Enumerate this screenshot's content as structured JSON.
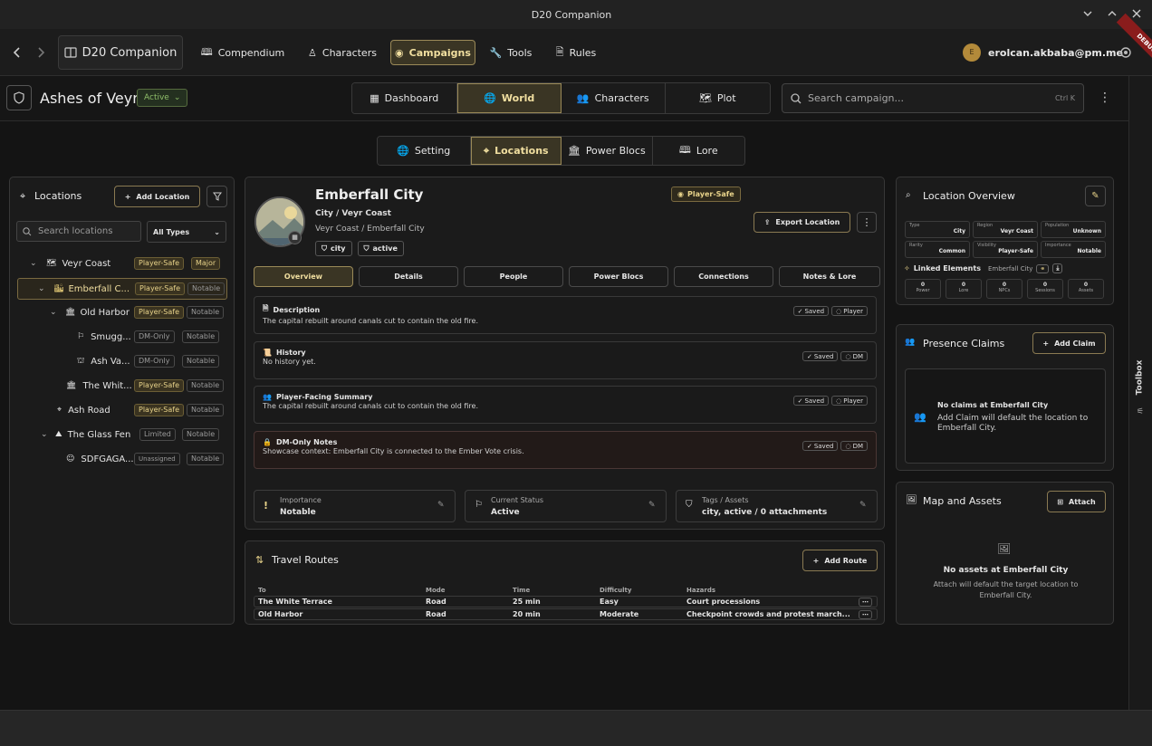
{
  "window": {
    "title": "D20 Companion"
  },
  "nav": {
    "app": "D20 Companion",
    "items": [
      "Compendium",
      "Characters",
      "Campaigns",
      "Tools",
      "Rules"
    ],
    "active": "Campaigns",
    "user": "erolcan.akbaba@pm.me",
    "avatar": "E",
    "debug": "DEBUG"
  },
  "campaign": {
    "name": "Ashes of Veyr",
    "status": "Active",
    "tabs": [
      "Dashboard",
      "World",
      "Characters",
      "Plot"
    ],
    "active_tab": "World",
    "search_placeholder": "Search campaign...",
    "shortcut": "Ctrl K"
  },
  "subtabs": {
    "items": [
      "Setting",
      "Locations",
      "Power Blocs",
      "Lore"
    ],
    "active": "Locations"
  },
  "left": {
    "title": "Locations",
    "add": "Add Location",
    "search_placeholder": "Search locations",
    "filter": "All Types",
    "tree": [
      {
        "label": "Veyr Coast",
        "badges": [
          "Player-Safe",
          "Major"
        ]
      },
      {
        "label": "Emberfall C...",
        "badges": [
          "Player-Safe",
          "Notable"
        ]
      },
      {
        "label": "Old Harbor",
        "badges": [
          "Player-Safe",
          "Notable"
        ]
      },
      {
        "label": "Smugg...",
        "badges": [
          "DM-Only",
          "Notable"
        ]
      },
      {
        "label": "Ash Va...",
        "badges": [
          "DM-Only",
          "Notable"
        ]
      },
      {
        "label": "The Whit...",
        "badges": [
          "Player-Safe",
          "Notable"
        ]
      },
      {
        "label": "Ash Road",
        "badges": [
          "Player-Safe",
          "Notable"
        ]
      },
      {
        "label": "The Glass Fen",
        "badges": [
          "Limited",
          "Notable"
        ]
      },
      {
        "label": "SDFGAGA...",
        "badges": [
          "Unassigned",
          "Notable"
        ]
      }
    ]
  },
  "detail": {
    "name": "Emberfall City",
    "type_line": "City / Veyr Coast",
    "path": "Veyr Coast / Emberfall City",
    "tags": [
      "city",
      "active"
    ],
    "visibility": "Player-Safe",
    "export": "Export Location",
    "tabs": [
      "Overview",
      "Details",
      "People",
      "Power Blocs",
      "Connections",
      "Notes & Lore"
    ],
    "active_tab": "Overview",
    "sections": [
      {
        "title": "Description",
        "text": "The capital rebuilt around canals cut to contain the old fire.",
        "saved": "Saved",
        "audience": "Player"
      },
      {
        "title": "History",
        "text": "No history yet.",
        "saved": "Saved",
        "audience": "DM"
      },
      {
        "title": "Player-Facing Summary",
        "text": "The capital rebuilt around canals cut to contain the old fire.",
        "saved": "Saved",
        "audience": "Player"
      },
      {
        "title": "DM-Only Notes",
        "text": "Showcase context: Emberfall City is connected to the Ember Vote crisis.",
        "saved": "Saved",
        "audience": "DM"
      }
    ],
    "facts": [
      {
        "label": "Importance",
        "value": "Notable"
      },
      {
        "label": "Current Status",
        "value": "Active"
      },
      {
        "label": "Tags / Assets",
        "value": "city, active / 0 attachments"
      }
    ]
  },
  "routes": {
    "title": "Travel Routes",
    "add": "Add Route",
    "columns": [
      "To",
      "Mode",
      "Time",
      "Difficulty",
      "Hazards"
    ],
    "rows": [
      [
        "The White Terrace",
        "Road",
        "25 min",
        "Easy",
        "Court processions"
      ],
      [
        "Old Harbor",
        "Road",
        "20 min",
        "Moderate",
        "Checkpoint crowds and protest march..."
      ]
    ]
  },
  "overview": {
    "title": "Location Overview",
    "stats": [
      {
        "k": "Type",
        "v": "City"
      },
      {
        "k": "Region",
        "v": "Veyr Coast"
      },
      {
        "k": "Population",
        "v": "Unknown"
      },
      {
        "k": "Rarity",
        "v": "Common"
      },
      {
        "k": "Visibility",
        "v": "Player-Safe"
      },
      {
        "k": "Importance",
        "v": "Notable"
      }
    ],
    "linked_label": "Linked Elements",
    "linked_target": "Emberfall City",
    "counts": [
      {
        "n": "0",
        "l": "Power"
      },
      {
        "n": "0",
        "l": "Lore"
      },
      {
        "n": "0",
        "l": "NPCs"
      },
      {
        "n": "0",
        "l": "Sessions"
      },
      {
        "n": "0",
        "l": "Assets"
      }
    ]
  },
  "claims": {
    "title": "Presence Claims",
    "add": "Add Claim",
    "empty_title": "No claims at Emberfall City",
    "empty_text": "Add Claim will default the location to Emberfall City."
  },
  "assets": {
    "title": "Map and Assets",
    "attach": "Attach",
    "empty_title": "No assets at Emberfall City",
    "empty_text": "Attach will default the target location to Emberfall City."
  },
  "toolbox": "Toolbox"
}
